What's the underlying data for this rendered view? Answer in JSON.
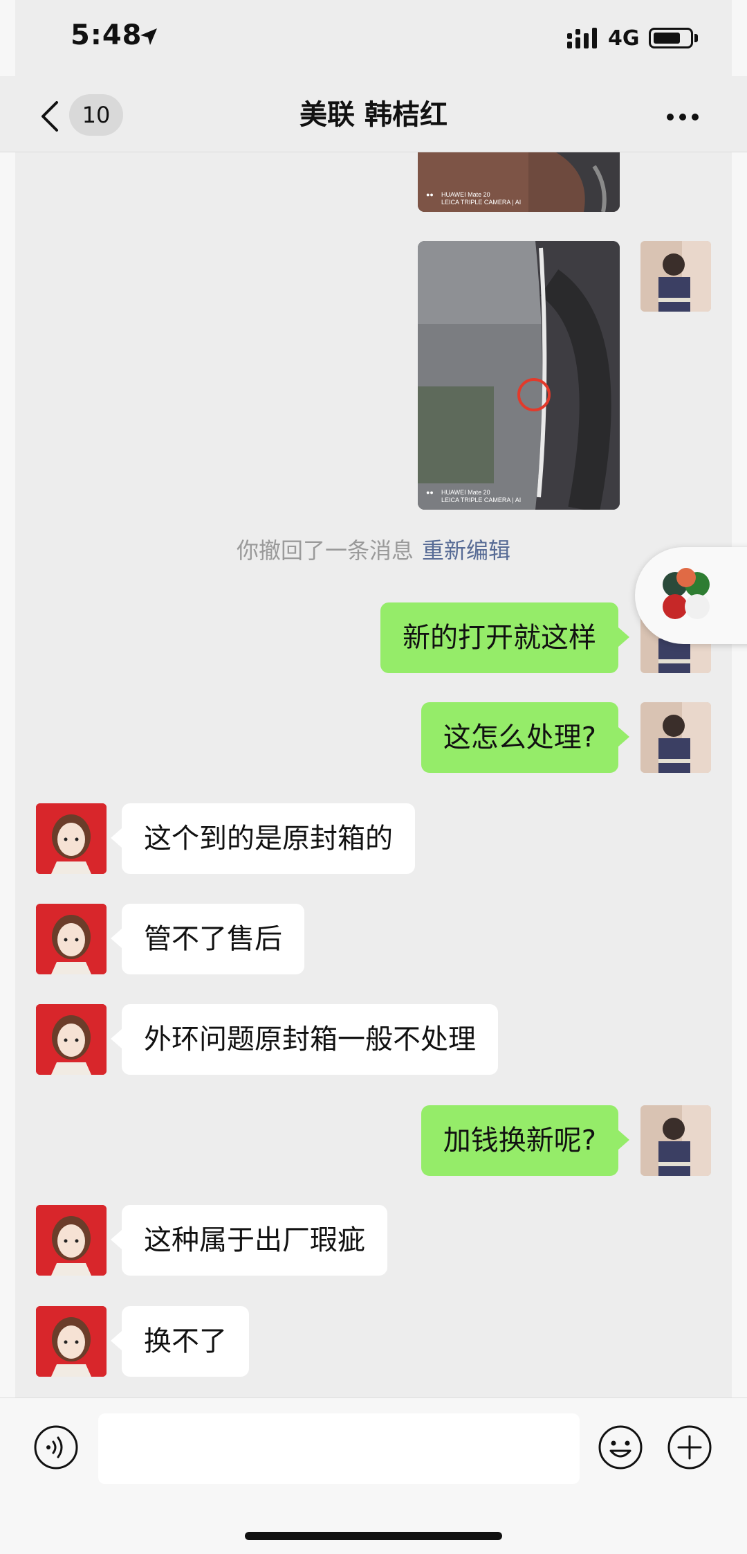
{
  "status_bar": {
    "time": "5:48",
    "network": "4G"
  },
  "nav": {
    "unread_count": "10",
    "title": "美联 韩桔红"
  },
  "photos": [
    {
      "caption_line1": "HUAWEI Mate 20",
      "caption_line2": "LEICA TRIPLE CAMERA | AI"
    },
    {
      "caption_line1": "HUAWEI Mate 20",
      "caption_line2": "LEICA TRIPLE CAMERA | AI"
    }
  ],
  "recall_notice": {
    "text": "你撤回了一条消息",
    "action": "重新编辑"
  },
  "messages": [
    {
      "side": "sent",
      "text": "新的打开就这样"
    },
    {
      "side": "sent",
      "text": "这怎么处理?"
    },
    {
      "side": "received",
      "text": "这个到的是原封箱的"
    },
    {
      "side": "received",
      "text": "管不了售后"
    },
    {
      "side": "received",
      "text": "外环问题原封箱一般不处理"
    },
    {
      "side": "sent",
      "text": "加钱换新呢?"
    },
    {
      "side": "received",
      "text": "这种属于出厂瑕疵"
    },
    {
      "side": "received",
      "text": "换不了"
    }
  ],
  "input": {
    "placeholder": ""
  },
  "colors": {
    "sent_bubble": "#95ec69",
    "received_bubble": "#ffffff",
    "link": "#576b95",
    "background": "#ededed",
    "avatar_bg": "#d8262b"
  },
  "icons": [
    "location-arrow-icon",
    "signal-icon",
    "battery-icon",
    "back-chevron-icon",
    "more-icon",
    "voice-icon",
    "emoji-icon",
    "plus-icon"
  ]
}
